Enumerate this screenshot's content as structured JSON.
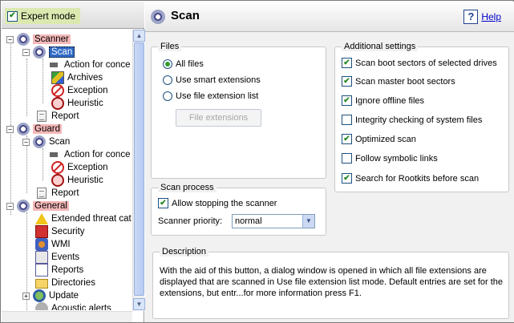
{
  "expert_mode": {
    "label": "Expert mode",
    "checked": true
  },
  "tree": {
    "scanner": "Scanner",
    "scanner_scan": "Scan",
    "scanner_scan_action": "Action for conce",
    "scanner_scan_archives": "Archives",
    "scanner_scan_exception": "Exception",
    "scanner_scan_heuristic": "Heuristic",
    "scanner_report": "Report",
    "guard": "Guard",
    "guard_scan": "Scan",
    "guard_scan_action": "Action for conce",
    "guard_scan_exception": "Exception",
    "guard_scan_heuristic": "Heuristic",
    "guard_report": "Report",
    "general": "General",
    "general_extended": "Extended threat cat",
    "general_security": "Security",
    "general_wmi": "WMI",
    "general_events": "Events",
    "general_reports": "Reports",
    "general_directories": "Directories",
    "general_update": "Update",
    "general_acoustic": "Acoustic alerts"
  },
  "header": {
    "title": "Scan",
    "help": "Help"
  },
  "files": {
    "title": "Files",
    "all_files": "All files",
    "smart_ext": "Use smart extensions",
    "file_ext_list": "Use file extension list",
    "file_ext_button": "File extensions",
    "selected": "all_files"
  },
  "additional": {
    "title": "Additional settings",
    "items": [
      {
        "label": "Scan boot sectors of selected drives",
        "checked": true
      },
      {
        "label": "Scan master boot sectors",
        "checked": true
      },
      {
        "label": "Ignore offline files",
        "checked": true
      },
      {
        "label": "Integrity checking of system files",
        "checked": false
      },
      {
        "label": "Optimized scan",
        "checked": true
      },
      {
        "label": "Follow symbolic links",
        "checked": false
      },
      {
        "label": "Search for Rootkits before scan",
        "checked": true
      }
    ]
  },
  "scan_process": {
    "title": "Scan process",
    "allow_stop": "Allow stopping the scanner",
    "allow_stop_checked": true,
    "priority_label": "Scanner priority:",
    "priority_value": "normal"
  },
  "description": {
    "title": "Description",
    "text": "With the aid of this button, a dialog window is opened in which all file extensions are displayed that are scanned in Use file extension list mode. Default entries are set for the extensions, but entr...for more information press F1."
  },
  "colors": {
    "selected": "#316ac5",
    "highlight": "#f4b8b8",
    "expert_bg": "#dbe9b0",
    "check": "#2a8a2a"
  }
}
